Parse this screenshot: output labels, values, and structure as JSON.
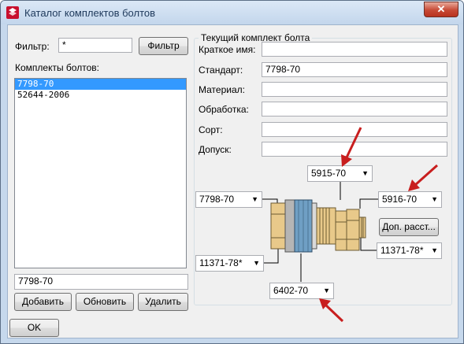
{
  "window": {
    "title": "Каталог комплектов болтов",
    "close_label": "✕"
  },
  "left": {
    "filter_label": "Фильтр:",
    "filter_value": "*",
    "filter_button": "Фильтр",
    "list_label": "Комплекты болтов:",
    "list_items": [
      "7798-70",
      "52644-2006"
    ],
    "selected_value": "7798-70",
    "add_button": "Добавить",
    "refresh_button": "Обновить",
    "delete_button": "Удалить"
  },
  "group": {
    "title": "Текущий комплект болта",
    "fields": [
      {
        "label": "Краткое имя:",
        "value": ""
      },
      {
        "label": "Стандарт:",
        "value": "7798-70"
      },
      {
        "label": "Материал:",
        "value": ""
      },
      {
        "label": "Обработка:",
        "value": ""
      },
      {
        "label": "Сорт:",
        "value": ""
      },
      {
        "label": "Допуск:",
        "value": ""
      }
    ],
    "combo_top": "5915-70",
    "combo_left": "7798-70",
    "combo_right": "5916-70",
    "combo_left_bottom": "11371-78*",
    "combo_right_bottom": "11371-78*",
    "combo_bottom": "6402-70",
    "extra_button": "Доп. расст..."
  },
  "ok_button": "OK",
  "colors": {
    "arrow": "#c81e1e",
    "bolt": "#e8c98a",
    "washer": "#6f9fc4"
  }
}
